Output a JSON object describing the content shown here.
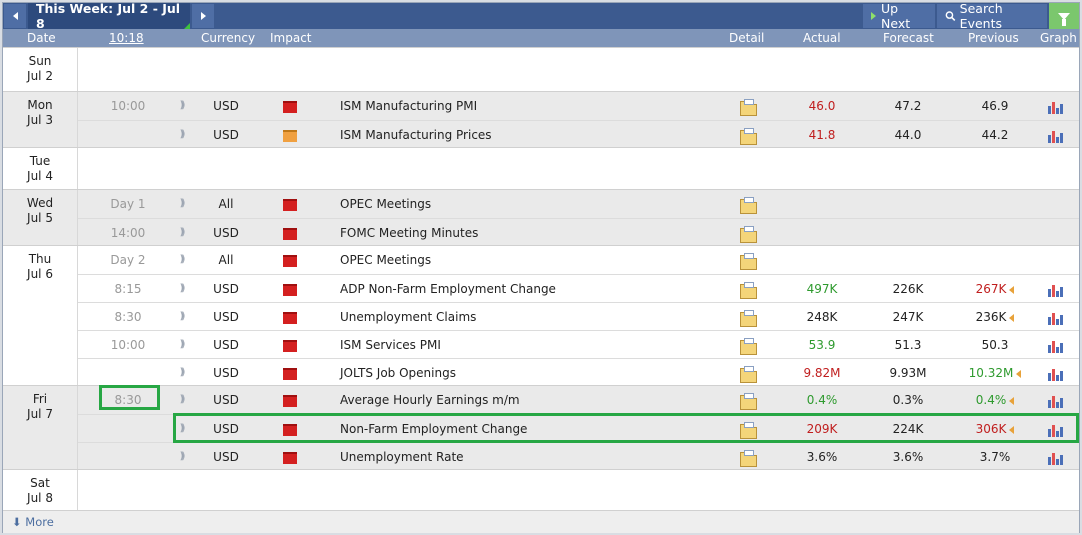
{
  "toolbar": {
    "prev_icon": "chevron-left-icon",
    "week_label": "This Week: Jul 2 - Jul 8",
    "next_icon": "chevron-right-icon",
    "up_next_label": "Up Next",
    "search_events_label": "Search Events",
    "filter_icon": "funnel-icon"
  },
  "columns": {
    "date": "Date",
    "time": "10:18",
    "currency": "Currency",
    "impact": "Impact",
    "detail": "Detail",
    "actual": "Actual",
    "forecast": "Forecast",
    "previous": "Previous",
    "graph": "Graph"
  },
  "days": [
    {
      "dow": "Sun",
      "date": "Jul 2"
    },
    {
      "dow": "Mon",
      "date": "Jul 3"
    },
    {
      "dow": "Tue",
      "date": "Jul 4"
    },
    {
      "dow": "Wed",
      "date": "Jul 5"
    },
    {
      "dow": "Thu",
      "date": "Jul 6"
    },
    {
      "dow": "Fri",
      "date": "Jul 7"
    },
    {
      "dow": "Sat",
      "date": "Jul 8"
    }
  ],
  "events": [
    {
      "time": "10:00",
      "currency": "USD",
      "impact": "high",
      "name": "ISM Manufacturing PMI",
      "actual": "46.0",
      "actual_color": "red",
      "forecast": "47.2",
      "previous": "46.9",
      "previous_color": "black",
      "revised": false,
      "graph": true
    },
    {
      "time": "",
      "currency": "USD",
      "impact": "medium",
      "name": "ISM Manufacturing Prices",
      "actual": "41.8",
      "actual_color": "red",
      "forecast": "44.0",
      "previous": "44.2",
      "previous_color": "black",
      "revised": false,
      "graph": true
    },
    {
      "time": "Day 1",
      "currency": "All",
      "impact": "high",
      "name": "OPEC Meetings",
      "actual": "",
      "forecast": "",
      "previous": "",
      "revised": false,
      "graph": false
    },
    {
      "time": "14:00",
      "currency": "USD",
      "impact": "high",
      "name": "FOMC Meeting Minutes",
      "actual": "",
      "forecast": "",
      "previous": "",
      "revised": false,
      "graph": false
    },
    {
      "time": "Day 2",
      "currency": "All",
      "impact": "high",
      "name": "OPEC Meetings",
      "actual": "",
      "forecast": "",
      "previous": "",
      "revised": false,
      "graph": false
    },
    {
      "time": "8:15",
      "currency": "USD",
      "impact": "high",
      "name": "ADP Non-Farm Employment Change",
      "actual": "497K",
      "actual_color": "green",
      "forecast": "226K",
      "previous": "267K",
      "previous_color": "red",
      "revised": true,
      "graph": true
    },
    {
      "time": "8:30",
      "currency": "USD",
      "impact": "high",
      "name": "Unemployment Claims",
      "actual": "248K",
      "actual_color": "black",
      "forecast": "247K",
      "previous": "236K",
      "previous_color": "black",
      "revised": true,
      "graph": true
    },
    {
      "time": "10:00",
      "currency": "USD",
      "impact": "high",
      "name": "ISM Services PMI",
      "actual": "53.9",
      "actual_color": "green",
      "forecast": "51.3",
      "previous": "50.3",
      "previous_color": "black",
      "revised": false,
      "graph": true
    },
    {
      "time": "",
      "currency": "USD",
      "impact": "high",
      "name": "JOLTS Job Openings",
      "actual": "9.82M",
      "actual_color": "red",
      "forecast": "9.93M",
      "previous": "10.32M",
      "previous_color": "green",
      "revised": true,
      "graph": true
    },
    {
      "time": "8:30",
      "currency": "USD",
      "impact": "high",
      "name": "Average Hourly Earnings m/m",
      "actual": "0.4%",
      "actual_color": "green",
      "forecast": "0.3%",
      "previous": "0.4%",
      "previous_color": "green",
      "revised": true,
      "graph": true
    },
    {
      "time": "",
      "currency": "USD",
      "impact": "high",
      "name": "Non-Farm Employment Change",
      "actual": "209K",
      "actual_color": "red",
      "forecast": "224K",
      "previous": "306K",
      "previous_color": "red",
      "revised": true,
      "graph": true
    },
    {
      "time": "",
      "currency": "USD",
      "impact": "high",
      "name": "Unemployment Rate",
      "actual": "3.6%",
      "actual_color": "black",
      "forecast": "3.6%",
      "previous": "3.7%",
      "previous_color": "black",
      "revised": false,
      "graph": true
    }
  ],
  "footer": {
    "more_label": "More",
    "more_icon": "download-arrow-icon"
  },
  "colors": {
    "header_bar": "#3c5a8f",
    "column_header": "#7f95b9",
    "impact_high": "#d42020",
    "impact_medium": "#f0a040",
    "highlight": "#27a744"
  }
}
